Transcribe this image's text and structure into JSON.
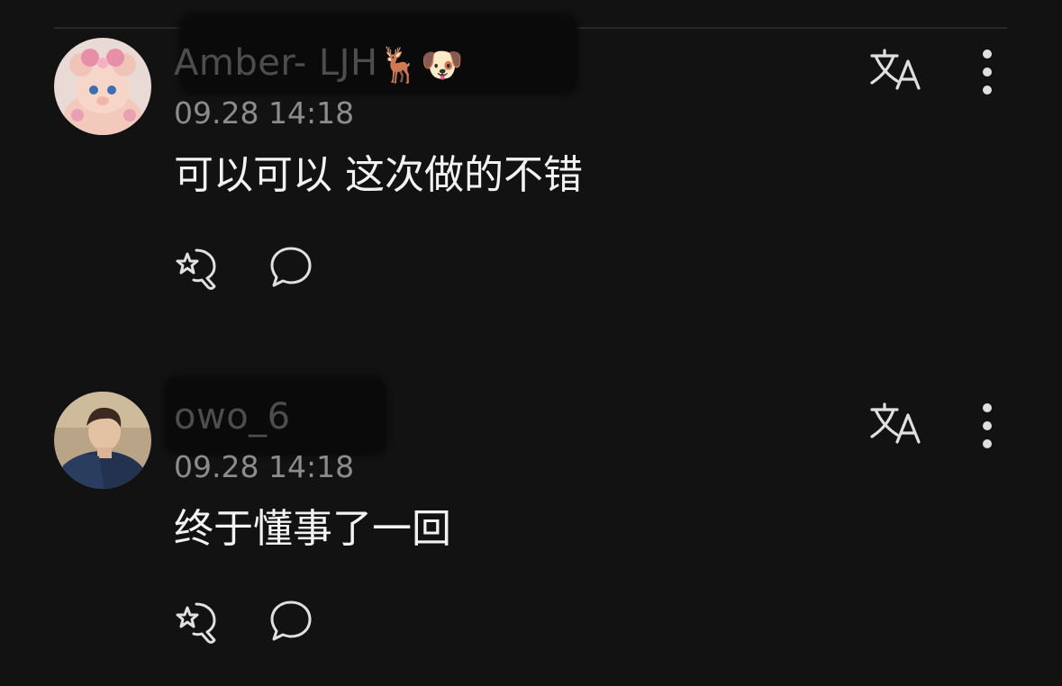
{
  "comments": [
    {
      "username": "Amber- LJH",
      "username_emoji": "🦌🐶",
      "timestamp": "09.28 14:18",
      "text": "可以可以 这次做的不错",
      "avatar_icon": "plush-bear-avatar",
      "actions": [
        "like-icon",
        "reply-icon"
      ]
    },
    {
      "username": "owo_6",
      "username_emoji": "",
      "timestamp": "09.28 14:18",
      "text": "终于懂事了一回",
      "avatar_icon": "person-photo-avatar",
      "actions": [
        "like-icon",
        "reply-icon"
      ]
    }
  ],
  "icons": {
    "translate": "translate-icon",
    "more": "more-vertical-icon"
  },
  "colors": {
    "background": "#121212",
    "primary_text": "#f2f2f2",
    "secondary_text": "#8c8c8c",
    "icon": "#e0e0e0"
  }
}
